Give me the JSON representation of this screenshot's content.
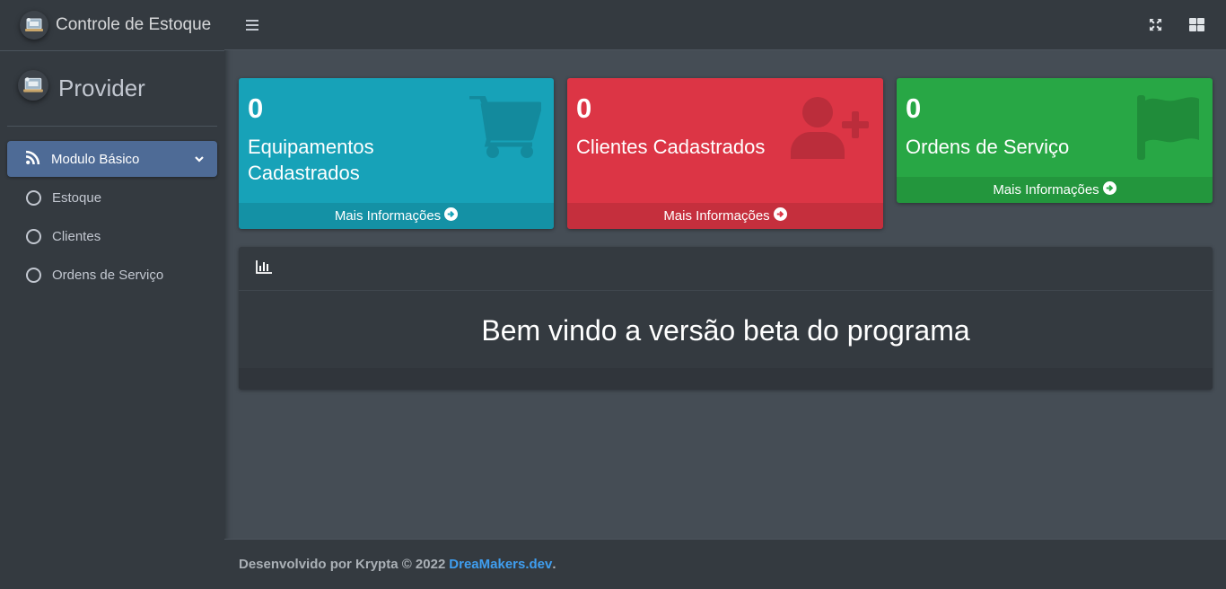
{
  "brand": {
    "title": "Controle de Estoque"
  },
  "user": {
    "name": "Provider"
  },
  "sidebar": {
    "items": [
      {
        "label": "Modulo Básico",
        "active": true,
        "icon": "rss-icon"
      },
      {
        "label": "Estoque",
        "icon": "circle-icon"
      },
      {
        "label": "Clientes",
        "icon": "circle-icon"
      },
      {
        "label": "Ordens de Serviço",
        "icon": "circle-icon"
      }
    ]
  },
  "header": {
    "icons": [
      "menu-icon",
      "fullscreen-icon",
      "grid-icon"
    ]
  },
  "cards": [
    {
      "count": "0",
      "title": "Equipamentos Cadastrados",
      "link": "Mais Informações",
      "color": "#17a2b8",
      "icon": "shopping-cart-icon"
    },
    {
      "count": "0",
      "title": "Clientes Cadastrados",
      "link": "Mais Informações",
      "color": "#dc3545",
      "icon": "user-plus-icon"
    },
    {
      "count": "0",
      "title": "Ordens de Serviço",
      "link": "Mais Informações",
      "color": "#28a745",
      "icon": "flag-icon"
    }
  ],
  "panel": {
    "icon": "chart-bar-icon",
    "message": "Bem vindo a versão beta do programa"
  },
  "footer": {
    "text": "Desenvolvido por Krypta © 2022",
    "link": "DreaMakers.dev",
    "suffix": "."
  }
}
